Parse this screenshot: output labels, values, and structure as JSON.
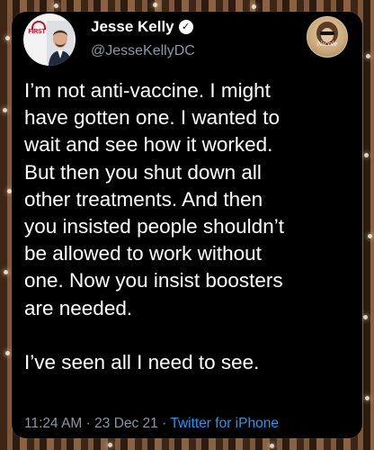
{
  "tweet": {
    "author_name": "Jesse Kelly",
    "author_handle": "@JesseKellyDC",
    "avatar_logo_text": "FIRST",
    "badge_script": "Nicole",
    "body": "I’m not anti-vaccine. I might\nhave gotten one. I wanted to\nwait and see how it worked.\nBut then you shut down all\nother treatments. And then\nyou insisted people shouldn’t\nbe allowed to work without\none. Now you insist boosters\nare needed.\n\nI’ve seen all I need to see.",
    "time": "11:24 AM",
    "separator": "·",
    "date": "23 Dec 21",
    "source": "Twitter for iPhone"
  },
  "colors": {
    "card_bg": "#000000",
    "text": "#ffffff",
    "muted": "#8b98a5",
    "link": "#1d9bf0",
    "logo_red": "#c0142b"
  },
  "icons": {
    "verified": "verified-badge-icon"
  }
}
